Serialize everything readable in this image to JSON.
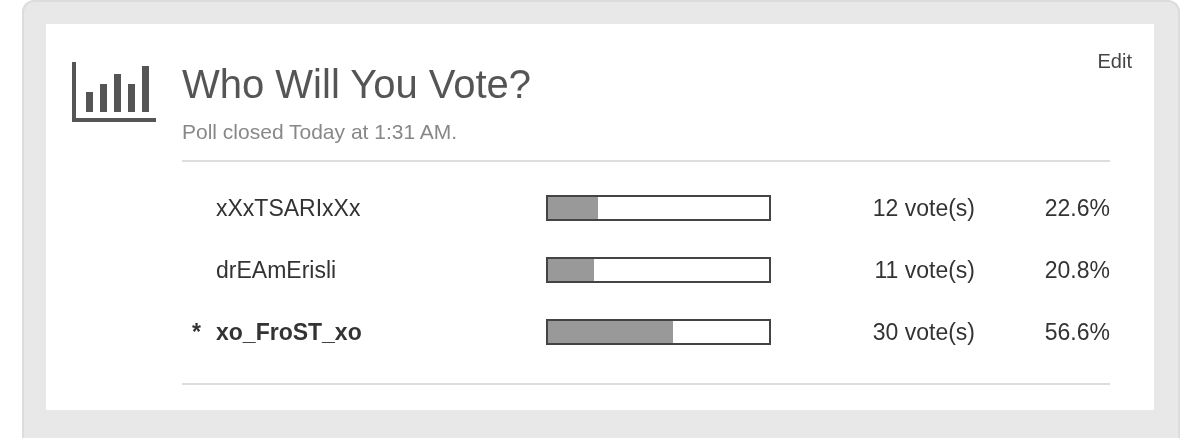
{
  "poll": {
    "title": "Who Will You Vote?",
    "status": "Poll closed Today at 1:31 AM.",
    "edit": "Edit",
    "options": [
      {
        "name": "xXxTSARIxXx",
        "selected": false,
        "level": 0.226,
        "votes": "12 vote(s)",
        "percent": "22.6%"
      },
      {
        "name": "drEAmErisli",
        "selected": false,
        "level": 0.208,
        "votes": "11 vote(s)",
        "percent": "20.8%"
      },
      {
        "prefix": "*",
        "name": "xo_FroST_xo",
        "selected": true,
        "level": 0.566,
        "votes": "30 vote(s)",
        "percent": "56.6%"
      }
    ]
  }
}
